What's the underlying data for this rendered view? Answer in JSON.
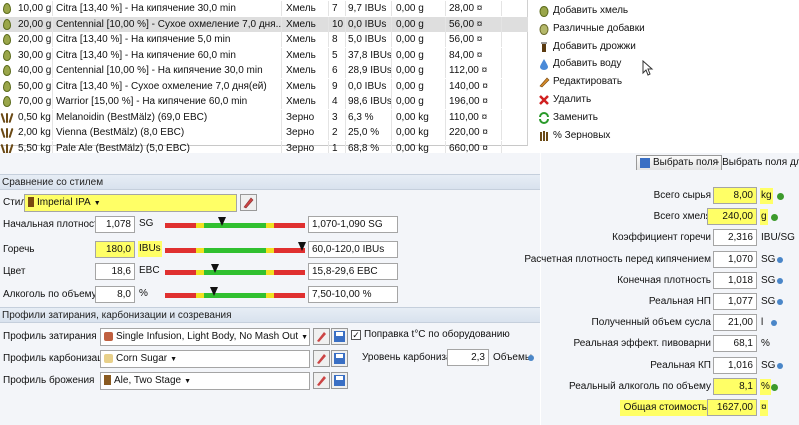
{
  "ingredients": [
    {
      "amount": "10,00 g",
      "icon": "hop-icon",
      "name": "Citra [13,40 %] - На кипячение 30,0 min",
      "type": "Хмель",
      "step": "7",
      "contrib": "9,7 IBUs",
      "percent": "0,00 g",
      "cost": "28,00 ¤"
    },
    {
      "amount": "20,00 g",
      "icon": "hop-icon",
      "name": "Centennial [10,00 %] - Сухое охмеление 7,0 дня...",
      "type": "Хмель",
      "step": "10",
      "contrib": "0,0 IBUs",
      "percent": "0,00 g",
      "cost": "56,00 ¤",
      "selected": true
    },
    {
      "amount": "20,00 g",
      "icon": "hop-icon",
      "name": "Citra [13,40 %] - На кипячение 5,0 min",
      "type": "Хмель",
      "step": "8",
      "contrib": "5,0 IBUs",
      "percent": "0,00 g",
      "cost": "56,00 ¤"
    },
    {
      "amount": "30,00 g",
      "icon": "hop-icon",
      "name": "Citra [13,40 %] - На кипячение 60,0 min",
      "type": "Хмель",
      "step": "5",
      "contrib": "37,8 IBUs",
      "percent": "0,00 g",
      "cost": "84,00 ¤"
    },
    {
      "amount": "40,00 g",
      "icon": "hop-icon",
      "name": "Centennial [10,00 %] - На кипячение 30,0 min",
      "type": "Хмель",
      "step": "6",
      "contrib": "28,9 IBUs",
      "percent": "0,00 g",
      "cost": "112,00 ¤"
    },
    {
      "amount": "50,00 g",
      "icon": "hop-icon",
      "name": "Citra [13,40 %] - Сухое охмеление 7,0 дня(ей)",
      "type": "Хмель",
      "step": "9",
      "contrib": "0,0 IBUs",
      "percent": "0,00 g",
      "cost": "140,00 ¤"
    },
    {
      "amount": "70,00 g",
      "icon": "hop-icon",
      "name": "Warrior [15,00 %] - На кипячение 60,0 min",
      "type": "Хмель",
      "step": "4",
      "contrib": "98,6 IBUs",
      "percent": "0,00 g",
      "cost": "196,00 ¤"
    },
    {
      "amount": "0,50 kg",
      "icon": "grain-icon",
      "name": "Melanoidin (BestMälz) (69,0 EBC)",
      "type": "Зерно",
      "step": "3",
      "contrib": "6,3 %",
      "percent": "0,00 kg",
      "cost": "110,00 ¤"
    },
    {
      "amount": "2,00 kg",
      "icon": "grain-icon",
      "name": "Vienna (BestMälz) (8,0 EBC)",
      "type": "Зерно",
      "step": "2",
      "contrib": "25,0 %",
      "percent": "0,00 kg",
      "cost": "220,00 ¤"
    },
    {
      "amount": "5,50 kg",
      "icon": "grain-icon",
      "name": "Pale Ale (BestMälz) (5,0 EBC)",
      "type": "Зерно",
      "step": "1",
      "contrib": "68,8 %",
      "percent": "0,00 kg",
      "cost": "660,00 ¤"
    }
  ],
  "actions": [
    {
      "label": "Добавить хмель",
      "icon": "hop-icon"
    },
    {
      "label": "Различные добавки",
      "icon": "misc-icon"
    },
    {
      "label": "Добавить дрожжи",
      "icon": "yeast-icon"
    },
    {
      "label": "Добавить воду",
      "icon": "water-drop-icon"
    },
    {
      "label": "Редактировать",
      "icon": "edit-icon"
    },
    {
      "label": "Удалить",
      "icon": "delete-x-icon"
    },
    {
      "label": "Заменить",
      "icon": "replace-icon"
    },
    {
      "label": "% Зерновых",
      "icon": "grain-percent-icon"
    }
  ],
  "style_section": {
    "header": "Сравнение со стилем",
    "style_label": "Стиль",
    "style_value": "Imperial IPA",
    "rows": [
      {
        "label": "Начальная плотность",
        "value": "1,078",
        "unit": "SG",
        "range": "1,070-1,090 SG",
        "marker_fraction": 0.41
      },
      {
        "label": "Горечь",
        "value": "180,0",
        "unit": "IBUs",
        "range": "60,0-120,0 IBUs",
        "marker_fraction": 0.98
      },
      {
        "label": "Цвет",
        "value": "18,6",
        "unit": "EBC",
        "range": "15,8-29,6 EBC",
        "marker_fraction": 0.36
      },
      {
        "label": "Алкоголь по объему",
        "value": "8,0",
        "unit": "%",
        "range": "7,50-10,00 %",
        "marker_fraction": 0.35
      }
    ]
  },
  "profiles": {
    "header": "Профили затирания, карбонизации и созревания",
    "mash_label": "Профиль затирания",
    "mash_value": "Single Infusion, Light Body, No Mash Out",
    "carb_label": "Профиль карбонизации",
    "carb_value": "Corn Sugar",
    "ferm_label": "Профиль брожения",
    "ferm_value": "Ale, Two Stage",
    "correction_label": "Поправка t°C по оборудованию",
    "carb_level_label": "Уровень карбонизации",
    "carb_level_value": "2,3",
    "carb_level_unit": "Объемы"
  },
  "stats": {
    "choose_fields_button": "Выбрать поля",
    "choose_fields_hint": "- Выбрать поля для",
    "rows": [
      {
        "label": "Всего сырья",
        "value": "8,00",
        "unit": "kg",
        "highlight": true,
        "dot": "green"
      },
      {
        "label": "Всего хмеля",
        "value": "240,00",
        "unit": "g",
        "highlight": true,
        "dot": "green"
      },
      {
        "label": "Коэффициент горечи",
        "value": "2,316",
        "unit": "IBU/SG",
        "dot": "blue"
      },
      {
        "label": "Расчетная плотность перед кипячением",
        "value": "1,070",
        "unit": "SG",
        "dot": "blue"
      },
      {
        "label": "Конечная плотность",
        "value": "1,018",
        "unit": "SG",
        "dot": "blue"
      },
      {
        "label": "Реальная НП",
        "value": "1,077",
        "unit": "SG",
        "dot": "blue"
      },
      {
        "label": "Полученный объем сусла",
        "value": "21,00",
        "unit": "l",
        "dot": "blue"
      },
      {
        "label": "Реальная эффект. пивоварни",
        "value": "68,1",
        "unit": "%",
        "dot": ""
      },
      {
        "label": "Реальная КП",
        "value": "1,016",
        "unit": "SG",
        "dot": "blue"
      },
      {
        "label": "Реальный алкоголь по объему",
        "value": "8,1",
        "unit": "%",
        "highlight": true,
        "dot": "green"
      },
      {
        "label": "Общая стоимость",
        "value": "1627,00",
        "unit": "¤",
        "highlight": true,
        "highlight_label": true,
        "dot": ""
      }
    ]
  }
}
